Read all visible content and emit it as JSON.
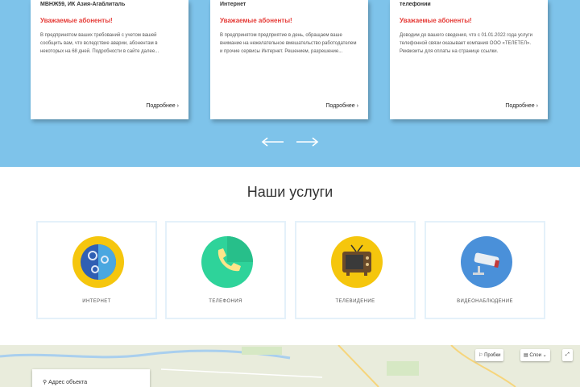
{
  "news": {
    "cards": [
      {
        "title": "МВНЖ59, ИК Азия-Агаблиталь",
        "alert": "Уважаемые абоненты!",
        "body": "В предпринятом ваших требований с учетом вашей сообщить вам, что вследствие аварии, абонентам в некоторых на 68 дней. Подробности в сайте далее...",
        "more": "Подробнее"
      },
      {
        "title": "Интернет",
        "alert": "Уважаемые абоненты!",
        "body": "В предпринятом предприятие в день, обращаем ваше внимание на нежелательное вмешательство работодателем и прочие сервисы Интернет. Решением, разрешение...",
        "more": "Подробнее"
      },
      {
        "title": "телефонии",
        "alert": "Уважаемые абоненты!",
        "body": "Доводим до вашего сведения, что с 01.01.2022 года услуги телефонной связи оказывает компания ООО «ТЕЛЕТЕЛ». Реквизиты для оплаты на странице ссылки.",
        "more": "Подробнее"
      }
    ],
    "prev_arrow": "⟵",
    "next_arrow": "⟶"
  },
  "services": {
    "title": "Наши услуги",
    "items": [
      {
        "label": "Интернет",
        "icon": "internet-globe-icon",
        "color": "#f5c60d"
      },
      {
        "label": "Телефония",
        "icon": "phone-handset-icon",
        "color": "#2ed39a"
      },
      {
        "label": "Телевидение",
        "icon": "tv-set-icon",
        "color": "#f5c60d"
      },
      {
        "label": "Видеонаблюдение",
        "icon": "cctv-camera-icon",
        "color": "#4a90d9"
      }
    ]
  },
  "map": {
    "traffic_label": "Пробки",
    "layers_label": "Слои",
    "search_label": "Адрес объекта"
  },
  "colors": {
    "band": "#7ec3ea",
    "alert": "#e53935"
  }
}
